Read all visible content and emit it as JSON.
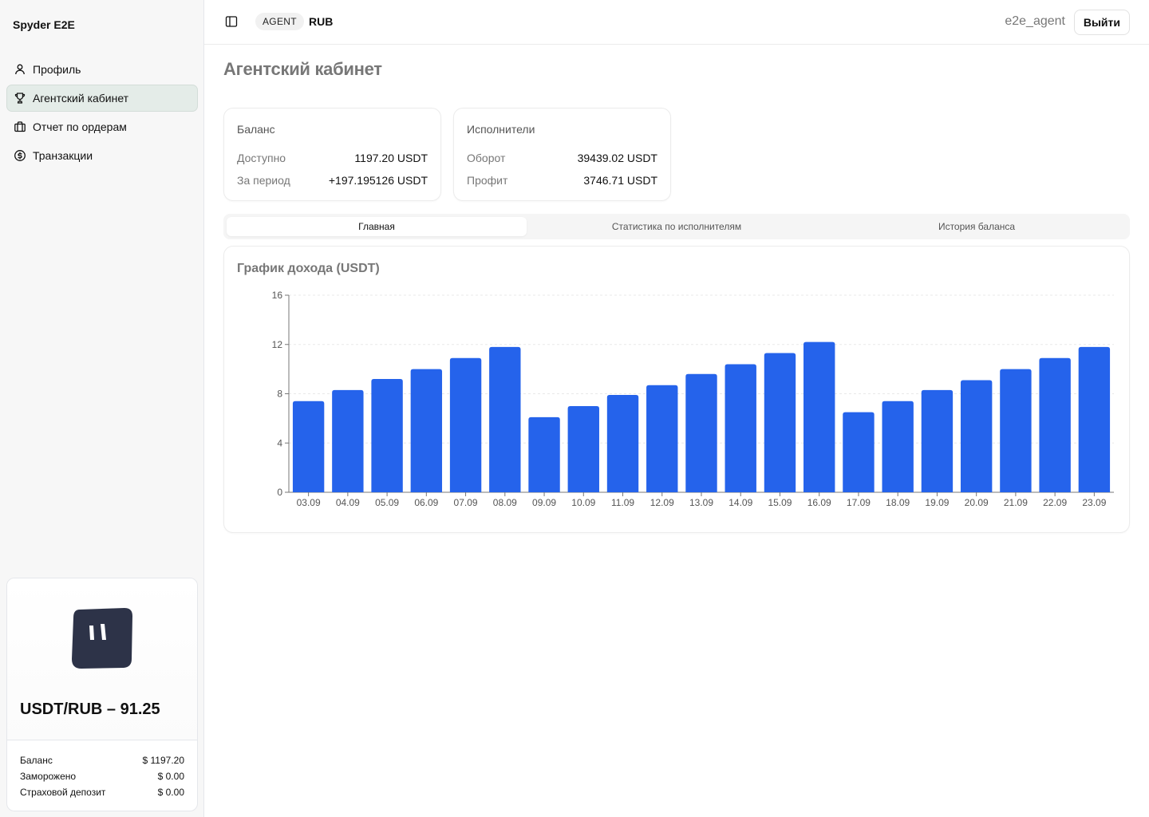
{
  "sidebar": {
    "brand": "Spyder E2E",
    "items": [
      {
        "label": "Профиль",
        "icon": "user-icon",
        "active": false
      },
      {
        "label": "Агентский кабинет",
        "icon": "trophy-icon",
        "active": true
      },
      {
        "label": "Отчет по ордерам",
        "icon": "briefcase-icon",
        "active": false
      },
      {
        "label": "Транзакции",
        "icon": "dollar-circle-icon",
        "active": false
      }
    ],
    "rate_card": {
      "rate": "USDT/RUB – 91.25",
      "rows": [
        {
          "label": "Баланс",
          "value": "$ 1197.20"
        },
        {
          "label": "Заморожено",
          "value": "$ 0.00"
        },
        {
          "label": "Страховой депозит",
          "value": "$ 0.00"
        }
      ]
    }
  },
  "header": {
    "role_badge": "AGENT",
    "currency": "RUB",
    "username": "e2e_agent",
    "logout_label": "Выйти"
  },
  "main": {
    "title": "Агентский кабинет",
    "balance_card": {
      "title": "Баланс",
      "rows": [
        {
          "label": "Доступно",
          "value": "1197.20 USDT"
        },
        {
          "label": "За период",
          "value": "+197.195126 USDT"
        }
      ]
    },
    "executors_card": {
      "title": "Исполнители",
      "rows": [
        {
          "label": "Оборот",
          "value": "39439.02 USDT"
        },
        {
          "label": "Профит",
          "value": "3746.71 USDT"
        }
      ]
    },
    "tabs": [
      {
        "label": "Главная",
        "active": true
      },
      {
        "label": "Статистика по исполнителям",
        "active": false
      },
      {
        "label": "История баланса",
        "active": false
      }
    ]
  },
  "colors": {
    "bar": "#2563eb",
    "active_nav": "#e4ece8"
  },
  "chart_data": {
    "type": "bar",
    "title": "График дохода (USDT)",
    "categories": [
      "03.09",
      "04.09",
      "05.09",
      "06.09",
      "07.09",
      "08.09",
      "09.09",
      "10.09",
      "11.09",
      "12.09",
      "13.09",
      "14.09",
      "15.09",
      "16.09",
      "17.09",
      "18.09",
      "19.09",
      "20.09",
      "21.09",
      "22.09",
      "23.09"
    ],
    "values": [
      7.4,
      8.3,
      9.2,
      10.0,
      10.9,
      11.8,
      6.1,
      7.0,
      7.9,
      8.7,
      9.6,
      10.4,
      11.3,
      12.2,
      6.5,
      7.4,
      8.3,
      9.1,
      10.0,
      10.9,
      11.8
    ],
    "ylim": [
      0,
      16
    ],
    "yticks": [
      "0",
      "4",
      "8",
      "12",
      "16"
    ],
    "grid": true,
    "legend": "none"
  }
}
